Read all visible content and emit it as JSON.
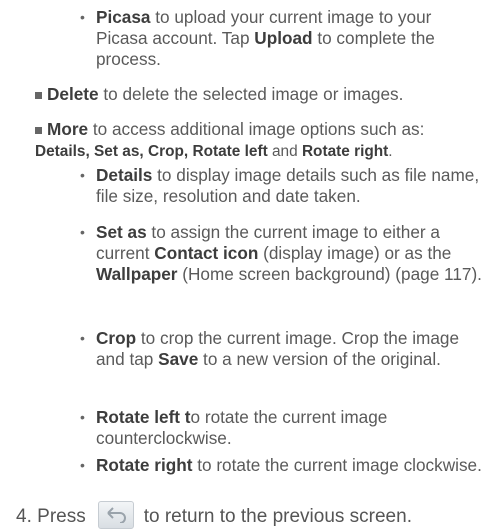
{
  "items": {
    "picasa": {
      "term": "Picasa",
      "text1": " to upload your current image to your Picasa account. Tap ",
      "action": "Upload",
      "text2": " to complete the process."
    },
    "delete": {
      "term": "Delete",
      "text": " to delete the selected image or images."
    },
    "more": {
      "term": "More",
      "text": " to access additional image options such as:",
      "o1": "Details",
      "s1": ", ",
      "o2": "Set as",
      "s2": ", ",
      "o3": "Crop",
      "s3": ", ",
      "o4": "Rotate left",
      "s4": " and ",
      "o5": "Rotate right",
      "s5": "."
    },
    "details": {
      "term": "Details",
      "text": " to display image details such as file name, file size, resolution and date taken."
    },
    "setas": {
      "term": "Set as",
      "text1": " to assign the current image to either a current ",
      "k1": "Contact icon",
      "text2": " (display image) or as the ",
      "k2": "Wallpaper",
      "text3": " (Home screen background) (page 117)."
    },
    "crop": {
      "term": "Crop",
      "text1": " to crop the current image. Crop the image and tap ",
      "k1": "Save",
      "text2": " to a new version of the original."
    },
    "rotleft": {
      "term": "Rotate left t",
      "text": "o rotate the current image counterclockwise."
    },
    "rotright": {
      "term": "Rotate right",
      "text": " to rotate the current image clockwise."
    }
  },
  "step4": {
    "num": "4.",
    "pre": "Press",
    "post": "to return to the previous screen.",
    "icon": "back-arrow-icon"
  }
}
